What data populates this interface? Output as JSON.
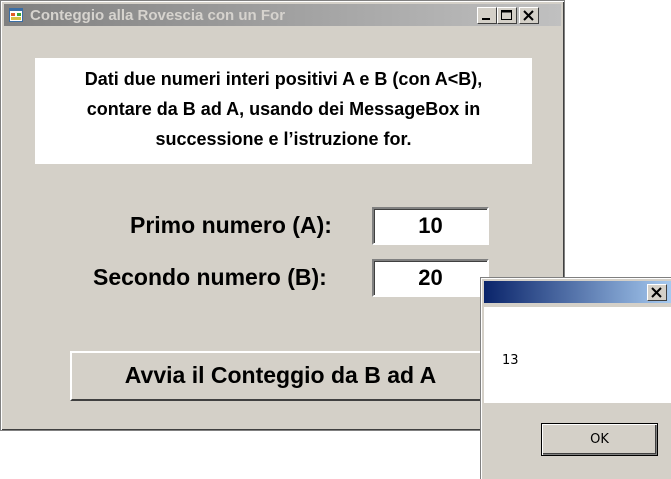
{
  "window": {
    "title": "Conteggio alla Rovescia con un For",
    "buttons": {
      "minimize": "minimize-icon",
      "maximize": "maximize-icon",
      "close": "close-icon"
    }
  },
  "instructions": {
    "line1": "Dati due numeri interi positivi A e B (con A<B),",
    "line2": "contare da B ad A, usando dei MessageBox in",
    "line3": "successione e l’istruzione for."
  },
  "form": {
    "primo_label": "Primo numero (A):",
    "primo_value": "10",
    "secondo_label": "Secondo numero (B):",
    "secondo_value": "20",
    "start_button": "Avvia il Conteggio da B ad A"
  },
  "messagebox": {
    "title": "",
    "text": "13",
    "ok_label": "OK"
  },
  "colors": {
    "inactive_title_start": "#808080",
    "inactive_title_end": "#c0c0c0",
    "active_title_start": "#0a246a",
    "active_title_end": "#a6caf0",
    "window_bg": "#d4d0c8"
  }
}
